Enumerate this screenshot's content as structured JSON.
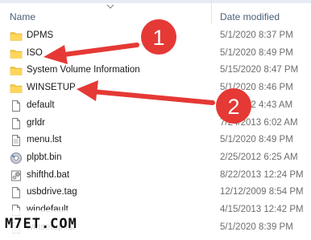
{
  "header": {
    "name_label": "Name",
    "date_label": "Date modified"
  },
  "files": [
    {
      "name": "DPMS",
      "date": "5/1/2020 8:37 PM",
      "icon": "folder-icon"
    },
    {
      "name": "ISO",
      "date": "5/1/2020 8:49 PM",
      "icon": "folder-icon"
    },
    {
      "name": "System Volume Information",
      "date": "5/15/2020 8:47 PM",
      "icon": "folder-icon"
    },
    {
      "name": "WINSETUP",
      "date": "5/1/2020 8:46 PM",
      "icon": "folder-icon"
    },
    {
      "name": "default",
      "date": "2/1/2012 4:43 AM",
      "icon": "file-icon"
    },
    {
      "name": "grldr",
      "date": "7/24/2013 6:02 AM",
      "icon": "file-icon"
    },
    {
      "name": "menu.lst",
      "date": "5/1/2020 8:49 PM",
      "icon": "text-file-icon"
    },
    {
      "name": "plpbt.bin",
      "date": "2/25/2012 6:25 AM",
      "icon": "bin-file-icon"
    },
    {
      "name": "shifthd.bat",
      "date": "8/22/2013 12:24 PM",
      "icon": "batch-file-icon"
    },
    {
      "name": "usbdrive.tag",
      "date": "12/12/2009 8:54 PM",
      "icon": "file-icon"
    },
    {
      "name": "windefault",
      "date": "4/15/2013 12:42 PM",
      "icon": "file-icon"
    },
    {
      "name": "winsetup.lst",
      "date": "5/1/2020 8:39 PM",
      "icon": "text-file-icon"
    }
  ],
  "annotations": [
    {
      "label": "1"
    },
    {
      "label": "2"
    }
  ],
  "watermark": {
    "text": "M7ET.COM"
  },
  "colors": {
    "annotation_red": "#e53935",
    "folder_yellow": "#f3c845",
    "header_text": "#4c607a"
  }
}
